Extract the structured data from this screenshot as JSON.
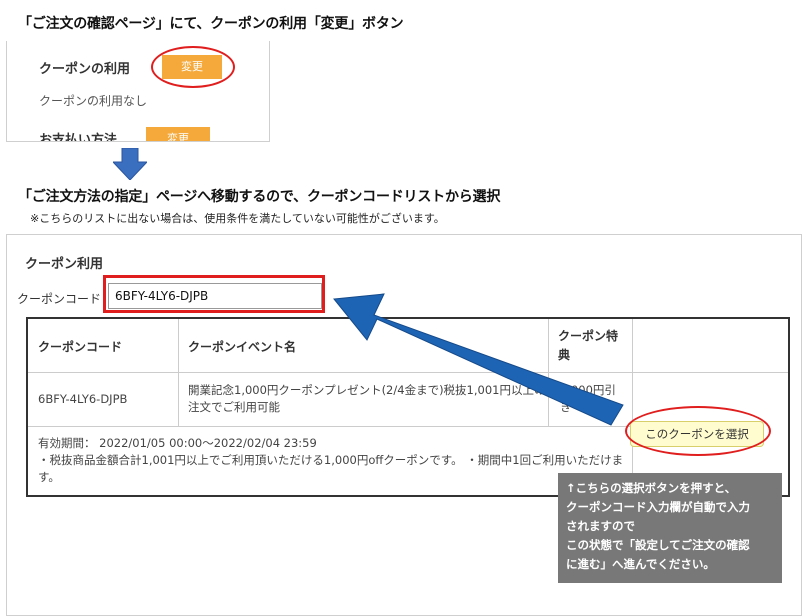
{
  "headings": {
    "step1": "「ご注文の確認ページ」にて、クーポンの利用「変更」ボタン",
    "step2": "「ご注文方法の指定」ページへ移動するので、クーポンコードリストから選択",
    "note": "※こちらのリストに出ない場合は、使用条件を満たしていない可能性がございます。"
  },
  "top_panel": {
    "coupon_label": "クーポンの利用",
    "change_label": "変更",
    "coupon_status": "クーポンの利用なし",
    "payment_label": "お支払い方法",
    "payment_change_label": "変更"
  },
  "coupon_form": {
    "title": "クーポン利用",
    "code_label": "クーポンコード",
    "code_value": "6BFY-4LY6-DJPB"
  },
  "table": {
    "headers": [
      "クーポンコード",
      "クーポンイベント名",
      "クーポン特典"
    ],
    "row": {
      "code": "6BFY-4LY6-DJPB",
      "event": "開業記念1,000円クーポンプレゼント(2/4金まで)税抜1,001円以上のご注文でご利用可能",
      "benefit": "1,000円引き",
      "period": "有効期間： 2022/01/05 00:00～2022/02/04 23:59",
      "details": "・税抜商品金額合計1,001円以上でご利用頂いただける1,000円offクーポンです。 ・期間中1回ご利用いただけます。",
      "select_label": "このクーポンを選択"
    }
  },
  "tooltip": {
    "line1": "↑こちらの選択ボタンを押すと、",
    "line2": "クーポンコード入力欄が自動で入力",
    "line3": "されますので",
    "line4": "この状態で「設定してご注文の確認",
    "line5": "に進む」へ進んでください。"
  },
  "colors": {
    "orange": "#f5a93a",
    "highlight_red": "#e01e1e",
    "arrow_blue": "#1e64b4",
    "tooltip_bg": "#787878",
    "select_btn_bg": "#fffccf"
  },
  "icons": {
    "down_arrow": "down-arrow-icon",
    "pointer_arrow": "pointer-arrow-icon"
  }
}
